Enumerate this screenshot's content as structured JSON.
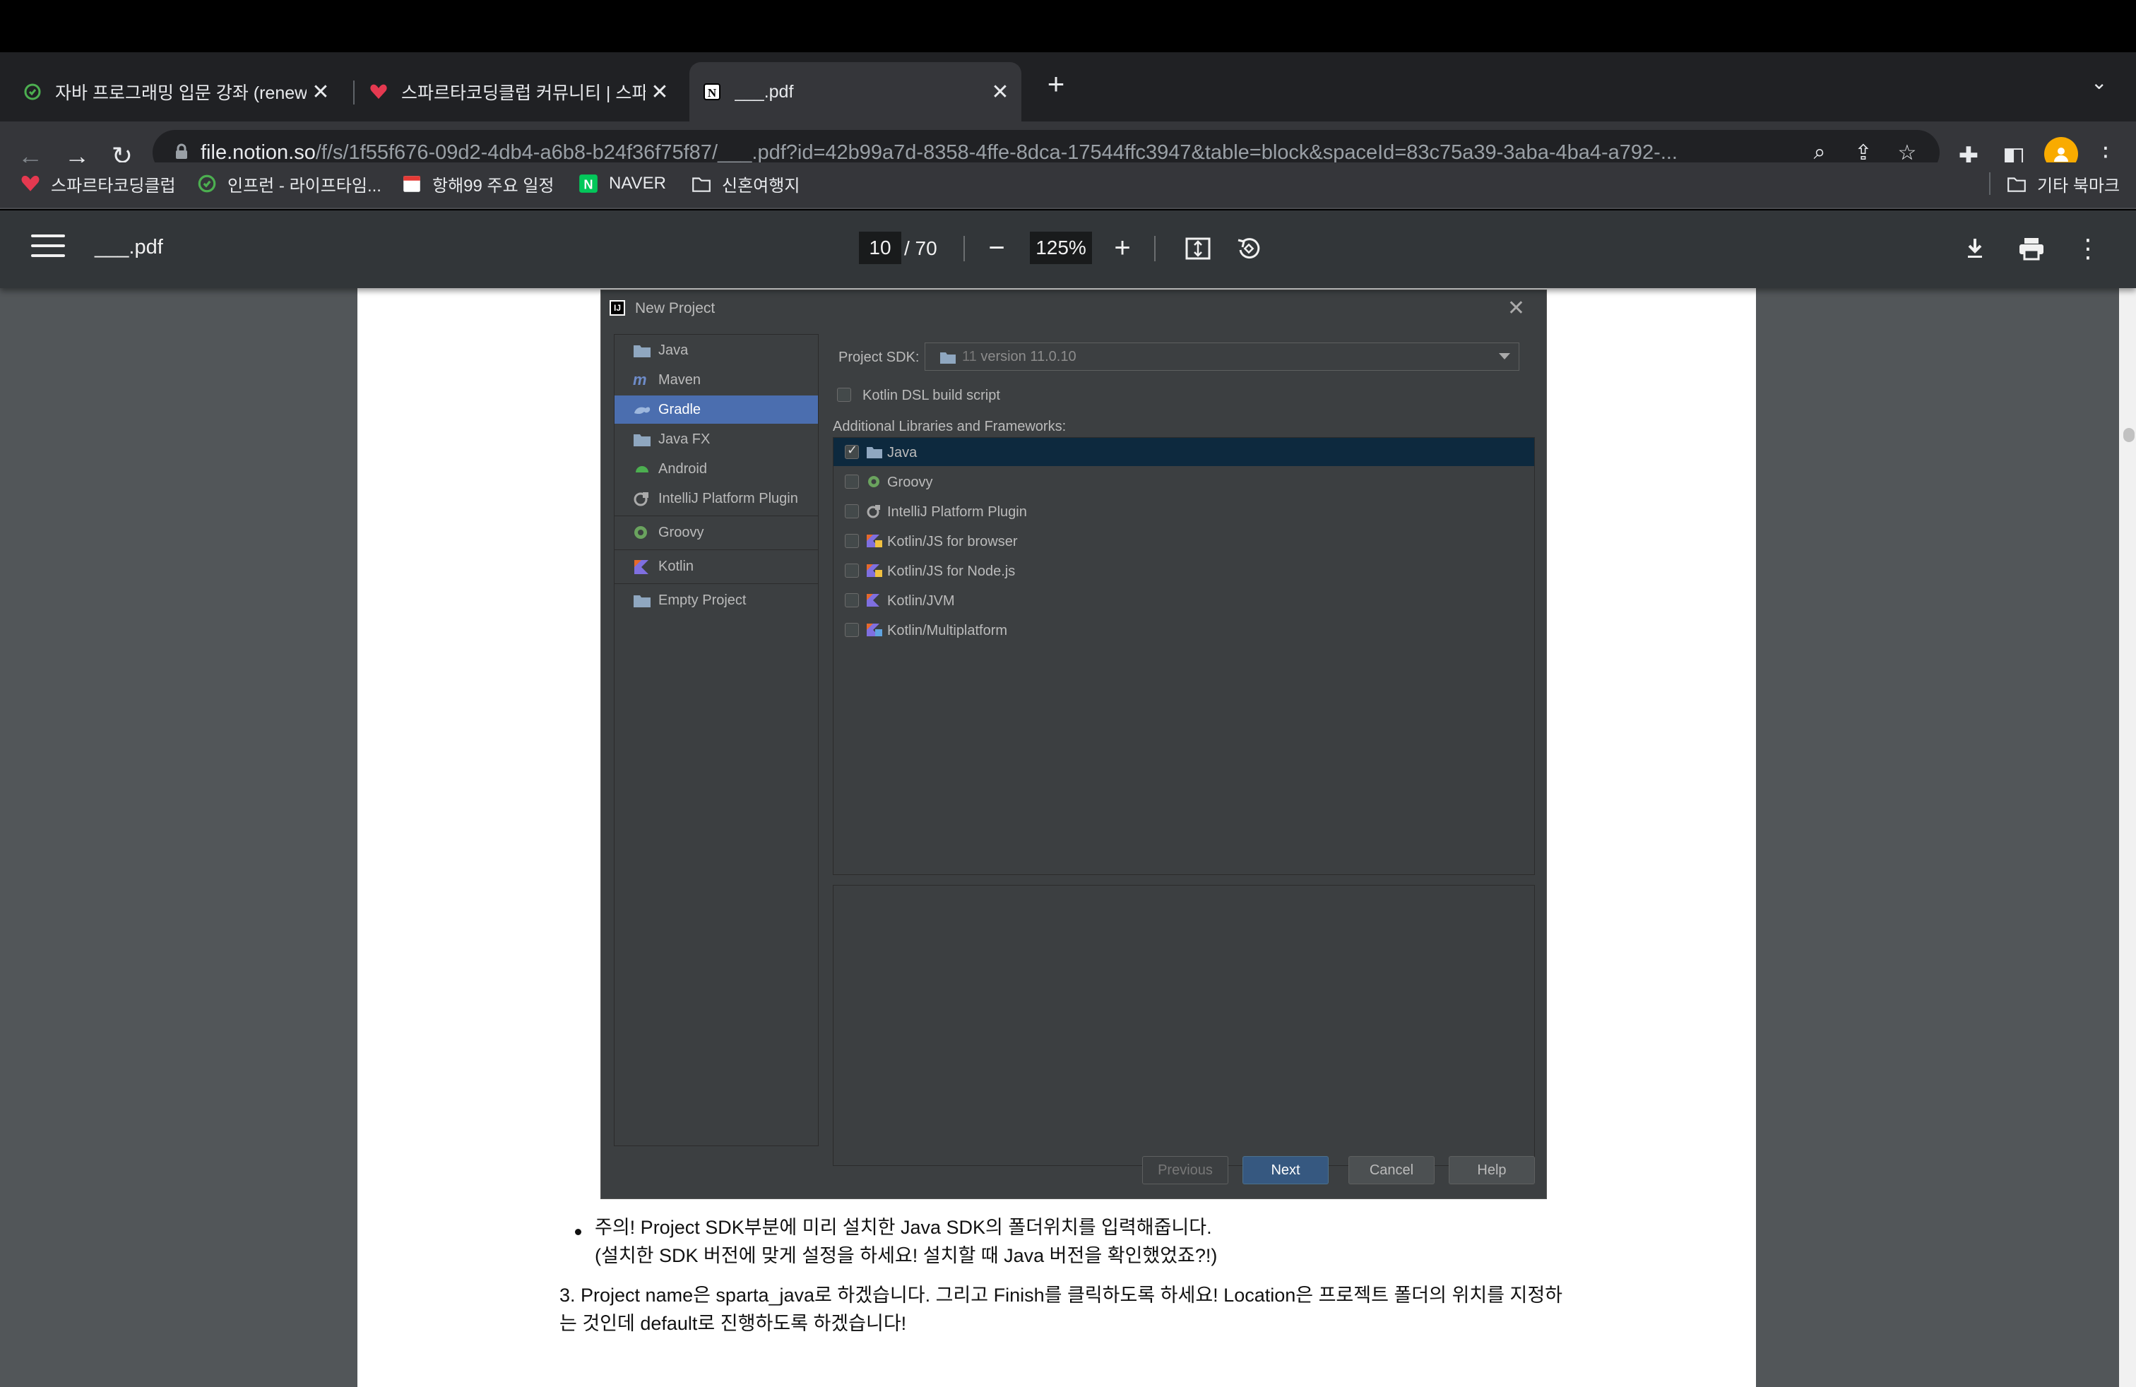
{
  "tabs": [
    {
      "title": "자바 프로그래밍 입문 강좌 (renew v",
      "active": false
    },
    {
      "title": "스파르타코딩클럽 커뮤니티 | 스파르타",
      "active": false
    },
    {
      "title": "___.pdf",
      "active": true
    }
  ],
  "toolbar": {
    "url_host": "file.notion.so",
    "url_path": "/f/s/1f55f676-09d2-4db4-a6b8-b24f36f75f87/___.pdf?id=42b99a7d-8358-4ffe-8dca-17544ffc3947&table=block&spaceId=83c75a39-3aba-4ba4-a792-..."
  },
  "bookmarks": [
    {
      "label": "스파르타코딩클럽",
      "icon": "heart-icon"
    },
    {
      "label": "인프런 - 라이프타임...",
      "icon": "inflearn-icon"
    },
    {
      "label": "항해99 주요 일정",
      "icon": "calendar-icon"
    },
    {
      "label": "NAVER",
      "icon": "naver-icon"
    },
    {
      "label": "신혼여행지",
      "icon": "folder-icon"
    }
  ],
  "other_bookmarks": "기타 북마크",
  "pdf": {
    "filename": "___.pdf",
    "page_current": "10",
    "page_total": "/ 70",
    "zoom": "125%"
  },
  "dialog": {
    "title": "New Project",
    "project_types": [
      "Java",
      "Maven",
      "Gradle",
      "Java FX",
      "Android",
      "IntelliJ Platform Plugin",
      "Groovy",
      "Kotlin",
      "Empty Project"
    ],
    "selected_type": "Gradle",
    "sdk_label": "Project SDK:",
    "sdk_value": "11",
    "sdk_version": "version 11.0.10",
    "kotlin_dsl": "Kotlin DSL build script",
    "additional_label": "Additional Libraries and Frameworks:",
    "frameworks": [
      {
        "label": "Java",
        "checked": true
      },
      {
        "label": "Groovy",
        "checked": false
      },
      {
        "label": "IntelliJ Platform Plugin",
        "checked": false
      },
      {
        "label": "Kotlin/JS for browser",
        "checked": false
      },
      {
        "label": "Kotlin/JS for Node.js",
        "checked": false
      },
      {
        "label": "Kotlin/JVM",
        "checked": false
      },
      {
        "label": "Kotlin/Multiplatform",
        "checked": false
      }
    ],
    "buttons": {
      "previous": "Previous",
      "next": "Next",
      "cancel": "Cancel",
      "help": "Help"
    }
  },
  "doc": {
    "bullet_line1": "주의! Project SDK부분에 미리 설치한 Java SDK의 폴더위치를 입력해줍니다.",
    "bullet_line2": "(설치한 SDK 버전에 맞게 설정을 하세요! 설치할 때 Java 버전을 확인했었죠?!)",
    "para_line1": "3. Project name은 sparta_java로 하겠습니다. 그리고 Finish를 클릭하도록 하세요! Location은 프로젝트 폴더의 위치를 지정하",
    "para_line2": "는 것인데 default로 진행하도록 하겠습니다!"
  }
}
